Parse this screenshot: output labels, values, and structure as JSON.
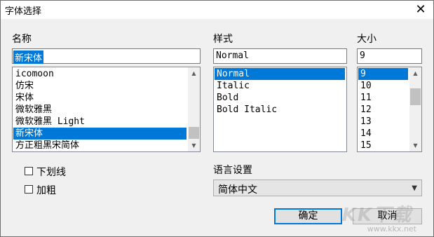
{
  "window": {
    "title": "字体选择",
    "close_symbol": "✕"
  },
  "font_name": {
    "label": "名称",
    "value": "新宋体",
    "items": [
      "icomoon",
      "仿宋",
      "宋体",
      "微软雅黑",
      "微软雅黑 Light",
      "新宋体",
      "方正粗黑宋简体"
    ],
    "selected_index": 5
  },
  "font_style": {
    "label": "样式",
    "value": "Normal",
    "items": [
      "Normal",
      "Italic",
      "Bold",
      "Bold Italic"
    ],
    "selected_index": 0
  },
  "font_size": {
    "label": "大小",
    "value": "9",
    "items": [
      "9",
      "10",
      "11",
      "12",
      "13",
      "14",
      "15"
    ],
    "selected_index": 0
  },
  "options": {
    "underline_label": "下划线",
    "underline_checked": false,
    "bold_label": "加粗",
    "bold_checked": false
  },
  "language": {
    "label": "语言设置",
    "value": "简体中文"
  },
  "buttons": {
    "ok": "确定",
    "cancel": "取消"
  },
  "watermark": {
    "url": "www.kkx.net",
    "logo": "KK下载"
  },
  "colors": {
    "selection": "#0078d7",
    "dialog_bg": "#f0f0f0",
    "default_button_border": "#0078d7"
  }
}
